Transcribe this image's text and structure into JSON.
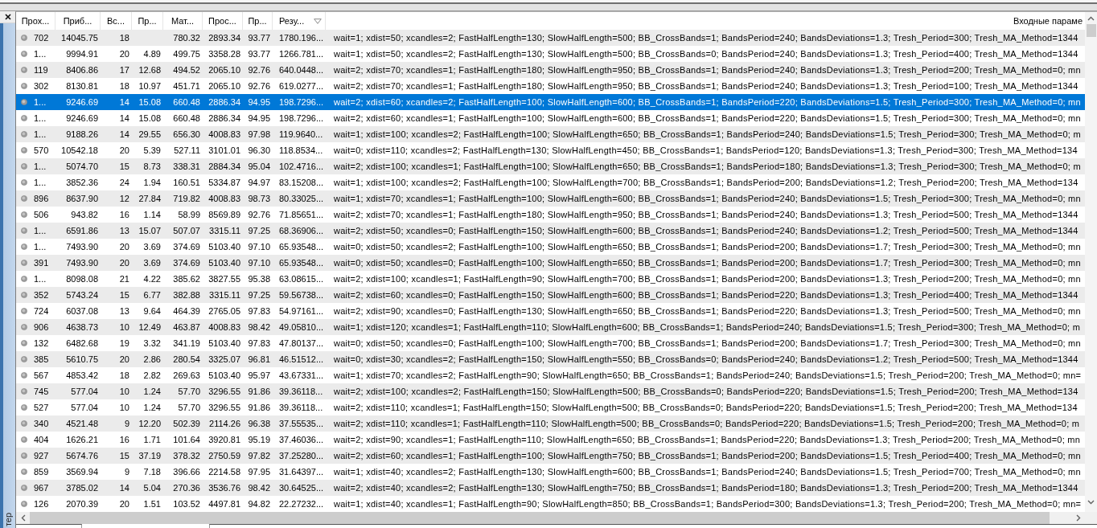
{
  "side_panel": {
    "label": "тер"
  },
  "table": {
    "columns": [
      {
        "label": "Прох...",
        "sorted": false
      },
      {
        "label": "Приб...",
        "sorted": false
      },
      {
        "label": "Вс...",
        "sorted": false
      },
      {
        "label": "Пр...",
        "sorted": false
      },
      {
        "label": "Мат...",
        "sorted": false
      },
      {
        "label": "Прос...",
        "sorted": false
      },
      {
        "label": "Пр...",
        "sorted": false
      },
      {
        "label": "Резу...",
        "sorted": true
      },
      {
        "label": "Входные параме",
        "sorted": false
      }
    ],
    "rows": [
      {
        "selected": false,
        "cells": [
          "702",
          "14045.75",
          "18",
          null,
          "780.32",
          "2893.34",
          "93.77",
          "1780.196...",
          "wait=1; xdist=50; xcandles=2; FastHalfLength=130; SlowHalfLength=500; BB_CrossBands=1; BandsPeriod=240; BandsDeviations=1.3; Tresh_Period=300; Tresh_MA_Method=1344"
        ]
      },
      {
        "selected": false,
        "cells": [
          "1...",
          "9994.91",
          "20",
          "4.89",
          "499.75",
          "3358.28",
          "93.77",
          "1266.781...",
          "wait=1; xdist=50; xcandles=2; FastHalfLength=130; SlowHalfLength=500; BB_CrossBands=0; BandsPeriod=240; BandsDeviations=1.3; Tresh_Period=400; Tresh_MA_Method=1344"
        ]
      },
      {
        "selected": false,
        "cells": [
          "119",
          "8406.86",
          "17",
          "12.68",
          "494.52",
          "2065.10",
          "92.76",
          "640.0448...",
          "wait=2; xdist=70; xcandles=1; FastHalfLength=180; SlowHalfLength=950; BB_CrossBands=1; BandsPeriod=240; BandsDeviations=1.3; Tresh_Period=200; Tresh_MA_Method=0; mn"
        ]
      },
      {
        "selected": false,
        "cells": [
          "302",
          "8130.81",
          "18",
          "10.97",
          "451.71",
          "2065.10",
          "92.76",
          "619.0277...",
          "wait=2; xdist=70; xcandles=1; FastHalfLength=180; SlowHalfLength=950; BB_CrossBands=1; BandsPeriod=240; BandsDeviations=1.3; Tresh_Period=100; Tresh_MA_Method=1344"
        ]
      },
      {
        "selected": true,
        "cells": [
          "1...",
          "9246.69",
          "14",
          "15.08",
          "660.48",
          "2886.34",
          "94.95",
          "198.7296...",
          "wait=2; xdist=60; xcandles=2; FastHalfLength=100; SlowHalfLength=600; BB_CrossBands=1; BandsPeriod=220; BandsDeviations=1.5; Tresh_Period=300; Tresh_MA_Method=0; mn"
        ]
      },
      {
        "selected": false,
        "cells": [
          "1...",
          "9246.69",
          "14",
          "15.08",
          "660.48",
          "2886.34",
          "94.95",
          "198.7296...",
          "wait=2; xdist=60; xcandles=1; FastHalfLength=100; SlowHalfLength=600; BB_CrossBands=1; BandsPeriod=220; BandsDeviations=1.5; Tresh_Period=300; Tresh_MA_Method=0; mn"
        ]
      },
      {
        "selected": false,
        "cells": [
          "1...",
          "9188.26",
          "14",
          "29.55",
          "656.30",
          "4008.83",
          "97.98",
          "119.9640...",
          "wait=1; xdist=100; xcandles=2; FastHalfLength=100; SlowHalfLength=650; BB_CrossBands=1; BandsPeriod=240; BandsDeviations=1.5; Tresh_Period=300; Tresh_MA_Method=0; m"
        ]
      },
      {
        "selected": false,
        "cells": [
          "570",
          "10542.18",
          "20",
          "5.39",
          "527.11",
          "3101.01",
          "96.30",
          "118.8534...",
          "wait=0; xdist=110; xcandles=2; FastHalfLength=130; SlowHalfLength=450; BB_CrossBands=1; BandsPeriod=120; BandsDeviations=1.3; Tresh_Period=300; Tresh_MA_Method=134"
        ]
      },
      {
        "selected": false,
        "cells": [
          "1...",
          "5074.70",
          "15",
          "8.73",
          "338.31",
          "2884.34",
          "95.04",
          "102.4716...",
          "wait=2; xdist=100; xcandles=1; FastHalfLength=100; SlowHalfLength=650; BB_CrossBands=1; BandsPeriod=180; BandsDeviations=1.3; Tresh_Period=300; Tresh_MA_Method=0; m"
        ]
      },
      {
        "selected": false,
        "cells": [
          "1...",
          "3852.36",
          "24",
          "1.94",
          "160.51",
          "5334.87",
          "94.97",
          "83.15208...",
          "wait=1; xdist=100; xcandles=2; FastHalfLength=100; SlowHalfLength=700; BB_CrossBands=1; BandsPeriod=200; BandsDeviations=1.2; Tresh_Period=200; Tresh_MA_Method=134"
        ]
      },
      {
        "selected": false,
        "cells": [
          "896",
          "8637.90",
          "12",
          "27.84",
          "719.82",
          "4008.83",
          "98.73",
          "80.33025...",
          "wait=1; xdist=70; xcandles=1; FastHalfLength=100; SlowHalfLength=600; BB_CrossBands=1; BandsPeriod=240; BandsDeviations=1.5; Tresh_Period=300; Tresh_MA_Method=0; mn"
        ]
      },
      {
        "selected": false,
        "cells": [
          "506",
          "943.82",
          "16",
          "1.14",
          "58.99",
          "8569.89",
          "92.76",
          "71.85651...",
          "wait=2; xdist=70; xcandles=1; FastHalfLength=180; SlowHalfLength=950; BB_CrossBands=1; BandsPeriod=240; BandsDeviations=1.3; Tresh_Period=500; Tresh_MA_Method=1344"
        ]
      },
      {
        "selected": false,
        "cells": [
          "1...",
          "6591.86",
          "13",
          "15.07",
          "507.07",
          "3315.11",
          "97.25",
          "68.36906...",
          "wait=2; xdist=50; xcandles=0; FastHalfLength=150; SlowHalfLength=600; BB_CrossBands=1; BandsPeriod=240; BandsDeviations=1.2; Tresh_Period=500; Tresh_MA_Method=1344"
        ]
      },
      {
        "selected": false,
        "cells": [
          "1...",
          "7493.90",
          "20",
          "3.69",
          "374.69",
          "5103.40",
          "97.10",
          "65.93548...",
          "wait=0; xdist=50; xcandles=2; FastHalfLength=100; SlowHalfLength=650; BB_CrossBands=1; BandsPeriod=200; BandsDeviations=1.7; Tresh_Period=300; Tresh_MA_Method=0; mn"
        ]
      },
      {
        "selected": false,
        "cells": [
          "391",
          "7493.90",
          "20",
          "3.69",
          "374.69",
          "5103.40",
          "97.10",
          "65.93548...",
          "wait=0; xdist=50; xcandles=0; FastHalfLength=100; SlowHalfLength=650; BB_CrossBands=1; BandsPeriod=200; BandsDeviations=1.7; Tresh_Period=300; Tresh_MA_Method=0; mn"
        ]
      },
      {
        "selected": false,
        "cells": [
          "1...",
          "8098.08",
          "21",
          "4.22",
          "385.62",
          "3827.55",
          "95.38",
          "63.08615...",
          "wait=2; xdist=100; xcandles=1; FastHalfLength=90; SlowHalfLength=700; BB_CrossBands=1; BandsPeriod=200; BandsDeviations=1.3; Tresh_Period=200; Tresh_MA_Method=0; mn"
        ]
      },
      {
        "selected": false,
        "cells": [
          "352",
          "5743.24",
          "15",
          "6.77",
          "382.88",
          "3315.11",
          "97.25",
          "59.56738...",
          "wait=2; xdist=60; xcandles=0; FastHalfLength=150; SlowHalfLength=600; BB_CrossBands=1; BandsPeriod=220; BandsDeviations=1.3; Tresh_Period=400; Tresh_MA_Method=1344"
        ]
      },
      {
        "selected": false,
        "cells": [
          "724",
          "6037.08",
          "13",
          "9.64",
          "464.39",
          "2765.05",
          "97.83",
          "54.97161...",
          "wait=2; xdist=90; xcandles=0; FastHalfLength=130; SlowHalfLength=650; BB_CrossBands=1; BandsPeriod=220; BandsDeviations=1.3; Tresh_Period=500; Tresh_MA_Method=0; mn"
        ]
      },
      {
        "selected": false,
        "cells": [
          "906",
          "4638.73",
          "10",
          "12.49",
          "463.87",
          "4008.83",
          "98.42",
          "49.05810...",
          "wait=1; xdist=120; xcandles=1; FastHalfLength=110; SlowHalfLength=600; BB_CrossBands=1; BandsPeriod=240; BandsDeviations=1.5; Tresh_Period=300; Tresh_MA_Method=0; m"
        ]
      },
      {
        "selected": false,
        "cells": [
          "132",
          "6482.68",
          "19",
          "3.32",
          "341.19",
          "5103.40",
          "97.83",
          "47.80137...",
          "wait=0; xdist=50; xcandles=0; FastHalfLength=100; SlowHalfLength=700; BB_CrossBands=1; BandsPeriod=200; BandsDeviations=1.7; Tresh_Period=300; Tresh_MA_Method=0; mn"
        ]
      },
      {
        "selected": false,
        "cells": [
          "385",
          "5610.75",
          "20",
          "2.86",
          "280.54",
          "3325.07",
          "96.81",
          "46.51512...",
          "wait=0; xdist=30; xcandles=2; FastHalfLength=150; SlowHalfLength=550; BB_CrossBands=0; BandsPeriod=240; BandsDeviations=1.2; Tresh_Period=500; Tresh_MA_Method=1344"
        ]
      },
      {
        "selected": false,
        "cells": [
          "567",
          "4853.42",
          "18",
          "2.82",
          "269.63",
          "5103.40",
          "95.97",
          "43.67331...",
          "wait=1; xdist=70; xcandles=2; FastHalfLength=90; SlowHalfLength=650; BB_CrossBands=1; BandsPeriod=240; BandsDeviations=1.5; Tresh_Period=200; Tresh_MA_Method=0; mn="
        ]
      },
      {
        "selected": false,
        "cells": [
          "745",
          "577.04",
          "10",
          "1.24",
          "57.70",
          "3296.55",
          "91.86",
          "39.36118...",
          "wait=2; xdist=100; xcandles=2; FastHalfLength=150; SlowHalfLength=500; BB_CrossBands=0; BandsPeriod=220; BandsDeviations=1.5; Tresh_Period=200; Tresh_MA_Method=134"
        ]
      },
      {
        "selected": false,
        "cells": [
          "527",
          "577.04",
          "10",
          "1.24",
          "57.70",
          "3296.55",
          "91.86",
          "39.36118...",
          "wait=2; xdist=110; xcandles=1; FastHalfLength=150; SlowHalfLength=500; BB_CrossBands=0; BandsPeriod=220; BandsDeviations=1.5; Tresh_Period=200; Tresh_MA_Method=134"
        ]
      },
      {
        "selected": false,
        "cells": [
          "340",
          "4521.48",
          "9",
          "12.20",
          "502.39",
          "2114.26",
          "96.38",
          "37.55535...",
          "wait=2; xdist=110; xcandles=1; FastHalfLength=110; SlowHalfLength=500; BB_CrossBands=0; BandsPeriod=220; BandsDeviations=1.5; Tresh_Period=200; Tresh_MA_Method=0; m"
        ]
      },
      {
        "selected": false,
        "cells": [
          "404",
          "1626.21",
          "16",
          "1.71",
          "101.64",
          "3920.81",
          "95.19",
          "37.46036...",
          "wait=2; xdist=90; xcandles=1; FastHalfLength=110; SlowHalfLength=650; BB_CrossBands=1; BandsPeriod=220; BandsDeviations=1.3; Tresh_Period=200; Tresh_MA_Method=0; mn"
        ]
      },
      {
        "selected": false,
        "cells": [
          "927",
          "5674.76",
          "15",
          "37.19",
          "378.32",
          "2750.59",
          "97.82",
          "37.25280...",
          "wait=2; xdist=60; xcandles=1; FastHalfLength=100; SlowHalfLength=750; BB_CrossBands=1; BandsPeriod=200; BandsDeviations=1.5; Tresh_Period=400; Tresh_MA_Method=0; mn"
        ]
      },
      {
        "selected": false,
        "cells": [
          "859",
          "3569.94",
          "9",
          "7.18",
          "396.66",
          "2214.58",
          "97.95",
          "31.64397...",
          "wait=1; xdist=40; xcandles=2; FastHalfLength=130; SlowHalfLength=600; BB_CrossBands=1; BandsPeriod=240; BandsDeviations=1.5; Tresh_Period=700; Tresh_MA_Method=0; mn"
        ]
      },
      {
        "selected": false,
        "cells": [
          "967",
          "3785.02",
          "14",
          "5.04",
          "270.36",
          "3536.76",
          "98.42",
          "30.64525...",
          "wait=2; xdist=40; xcandles=2; FastHalfLength=130; SlowHalfLength=750; BB_CrossBands=1; BandsPeriod=180; BandsDeviations=1.3; Tresh_Period=200; Tresh_MA_Method=1344"
        ]
      },
      {
        "selected": false,
        "cells": [
          "126",
          "2070.39",
          "20",
          "1.51",
          "103.52",
          "4497.81",
          "94.82",
          "22.27232...",
          "wait=1; xdist=40; xcandles=1; FastHalfLength=90; SlowHalfLength=850; BB_CrossBands=1; BandsPeriod=300; BandsDeviations=1.3; Tresh_Period=200; Tresh_MA_Method=0; mn="
        ]
      }
    ]
  }
}
